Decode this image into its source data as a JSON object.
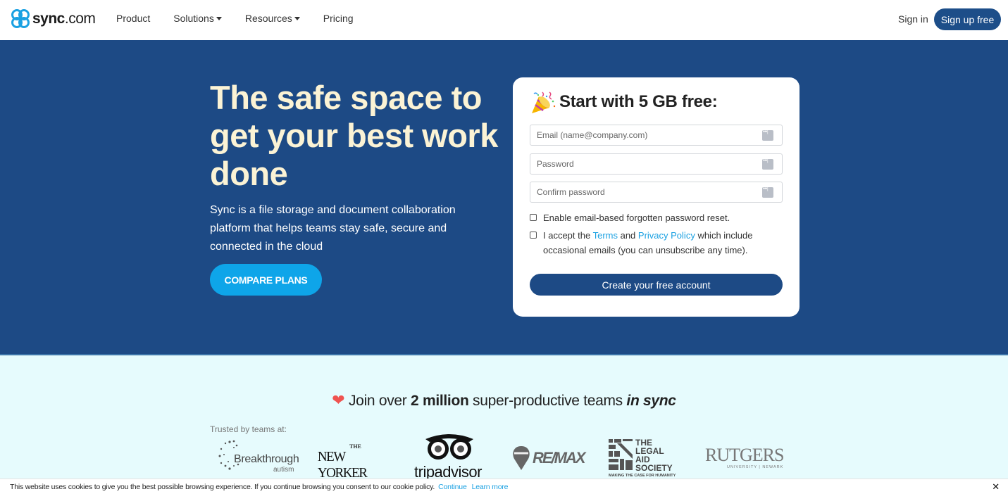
{
  "header": {
    "logo_bold": "sync",
    "logo_light": ".com",
    "nav": [
      {
        "label": "Product",
        "dropdown": false
      },
      {
        "label": "Solutions",
        "dropdown": true
      },
      {
        "label": "Resources",
        "dropdown": true
      },
      {
        "label": "Pricing",
        "dropdown": false
      }
    ],
    "sign_in": "Sign in",
    "sign_up": "Sign up free"
  },
  "hero": {
    "title": "The safe space to get your best work done",
    "description": "Sync is a file storage and document collaboration platform that helps teams stay safe, secure and connected in the cloud",
    "compare_button": "COMPARE PLANS"
  },
  "signup_card": {
    "title": "Start with 5 GB free:",
    "title_icon": "party-popper-icon",
    "fields": [
      {
        "placeholder": "Email (name@company.com)",
        "value": ""
      },
      {
        "placeholder": "Password",
        "value": ""
      },
      {
        "placeholder": "Confirm password",
        "value": ""
      }
    ],
    "checkbox_reset": {
      "label": "Enable email-based forgotten password reset.",
      "checked": false
    },
    "checkbox_terms": {
      "prefix": "I accept the ",
      "terms_link": "Terms",
      "middle": " and ",
      "privacy_link": "Privacy Policy",
      "suffix": " which include occasional emails (you can unsubscribe any time).",
      "checked": false
    },
    "create_button": "Create your free account"
  },
  "trust": {
    "join_prefix": "Join over ",
    "join_bold": "2 million",
    "join_middle": " super-productive teams ",
    "join_italic": "in sync",
    "trusted_label": "Trusted by teams at:",
    "logos": [
      {
        "name": "Breakthrough",
        "sub": "autism"
      },
      {
        "name": "NEW YORKER",
        "sup": "THE"
      },
      {
        "name": "tripadvisor"
      },
      {
        "name": "RE/MAX"
      },
      {
        "name": "THE LEGAL AID SOCIETY",
        "lines": [
          "THE",
          "LEGAL",
          "AID",
          "SOCIETY"
        ],
        "tagline": "MAKING THE CASE FOR HUMANITY"
      },
      {
        "name": "RUTGERS",
        "sub": "UNIVERSITY | NEWARK"
      }
    ]
  },
  "cookie_bar": {
    "text": "This website uses cookies to give you the best possible browsing experience. If you continue browsing you consent to our cookie policy.",
    "continue": "Continue",
    "learn_more": "Learn more",
    "close": "✕"
  },
  "colors": {
    "brand_navy": "#1d4a85",
    "accent_blue": "#0ea5e9",
    "link_blue": "#1ba1e2",
    "hero_title": "#fbf3d5",
    "trust_bg": "#e6fbfd"
  }
}
